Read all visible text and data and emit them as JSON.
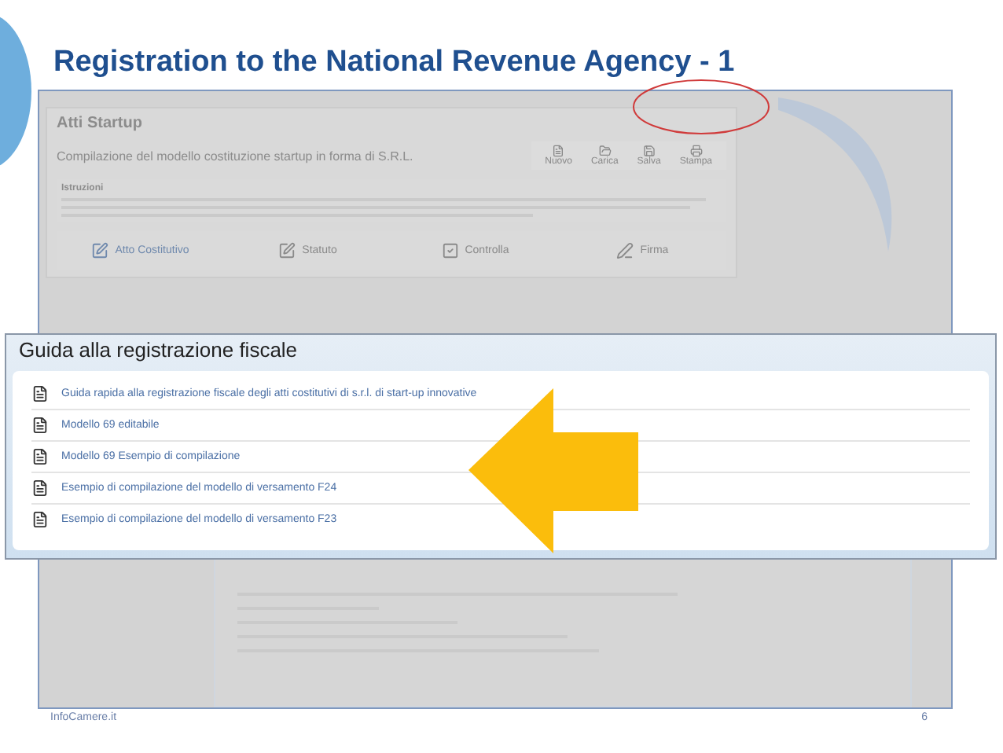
{
  "slide": {
    "title": "Registration to the National Revenue Agency - 1",
    "footer": "InfoCamere.it",
    "page_number": "6"
  },
  "background_app": {
    "title": "Atti Startup",
    "subtitle": "Compilazione del modello costituzione startup in forma di S.R.L.",
    "toolbar": [
      {
        "label": "Nuovo",
        "kind": "file"
      },
      {
        "label": "Carica",
        "kind": "folder"
      },
      {
        "label": "Salva",
        "kind": "save"
      },
      {
        "label": "Stampa",
        "kind": "print"
      }
    ],
    "instructions_heading": "Istruzioni",
    "steps": [
      {
        "label": "Atto Costitutivo",
        "kind": "edit",
        "selected": true
      },
      {
        "label": "Statuto",
        "kind": "edit",
        "selected": false
      },
      {
        "label": "Controlla",
        "kind": "check",
        "selected": false
      },
      {
        "label": "Firma",
        "kind": "sign",
        "selected": false
      }
    ]
  },
  "guide_panel": {
    "title": "Guida alla registrazione fiscale",
    "documents": [
      "Guida rapida alla registrazione fiscale degli atti costitutivi di s.r.l. di start-up innovative",
      "Modello 69 editabile",
      "Modello 69 Esempio di compilazione",
      "Esempio di compilazione del modello di versamento F24",
      "Esempio di compilazione del modello di versamento F23"
    ]
  }
}
